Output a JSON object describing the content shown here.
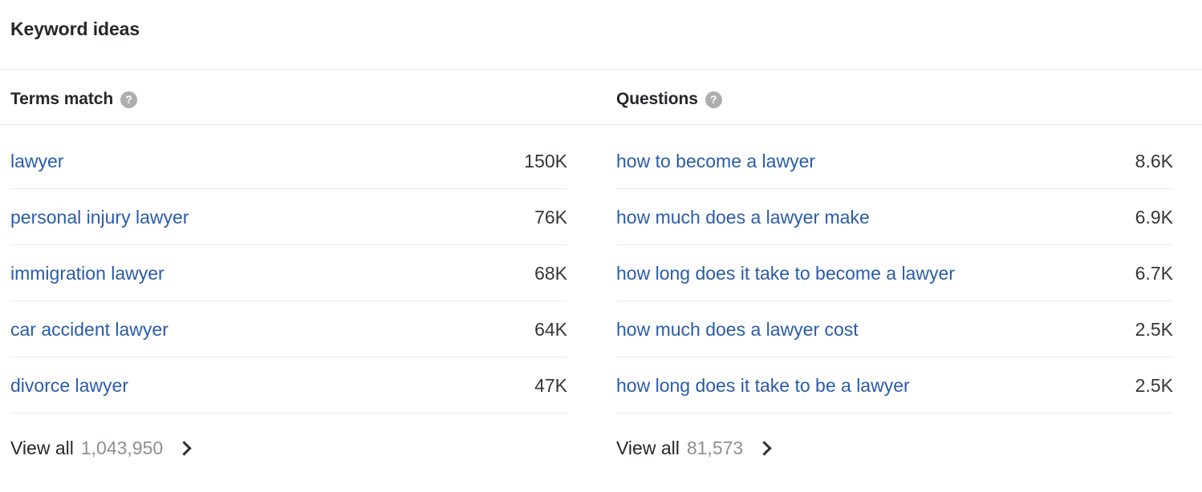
{
  "card": {
    "title": "Keyword ideas"
  },
  "columns": [
    {
      "id": "terms-match",
      "heading": "Terms match",
      "help_icon": "help-circle-icon",
      "help_glyph": "?",
      "rows": [
        {
          "keyword": "lawyer",
          "volume": "150K"
        },
        {
          "keyword": "personal injury lawyer",
          "volume": "76K"
        },
        {
          "keyword": "immigration lawyer",
          "volume": "68K"
        },
        {
          "keyword": "car accident lawyer",
          "volume": "64K"
        },
        {
          "keyword": "divorce lawyer",
          "volume": "47K"
        }
      ],
      "view_all": {
        "label": "View all",
        "count": "1,043,950",
        "chevron_icon": "chevron-right-icon"
      }
    },
    {
      "id": "questions",
      "heading": "Questions",
      "help_icon": "help-circle-icon",
      "help_glyph": "?",
      "rows": [
        {
          "keyword": "how to become a lawyer",
          "volume": "8.6K"
        },
        {
          "keyword": "how much does a lawyer make",
          "volume": "6.9K"
        },
        {
          "keyword": "how long does it take to become a lawyer",
          "volume": "6.7K"
        },
        {
          "keyword": "how much does a lawyer cost",
          "volume": "2.5K"
        },
        {
          "keyword": "how long does it take to be a lawyer",
          "volume": "2.5K"
        }
      ],
      "view_all": {
        "label": "View all",
        "count": "81,573",
        "chevron_icon": "chevron-right-icon"
      }
    }
  ],
  "colors": {
    "link": "#2a5caa",
    "value": "#333739",
    "muted": "#8c9093",
    "divider": "#e9eaeb",
    "help_icon_bg": "#aeaeae",
    "text": "#25282a"
  }
}
